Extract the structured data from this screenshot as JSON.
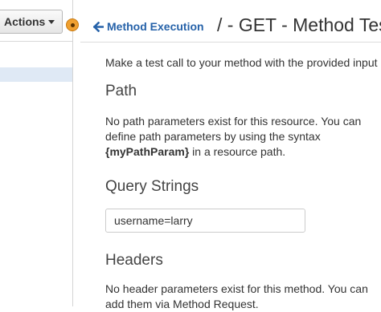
{
  "toolbar": {
    "actions_label": "Actions"
  },
  "header": {
    "back_label": "Method Execution",
    "title": "/ - GET - Method Test"
  },
  "main": {
    "intro": "Make a test call to your method with the provided input",
    "path": {
      "title": "Path",
      "text_before": "No path parameters exist for this resource. You can define path parameters by using the syntax ",
      "syntax": "{myPathParam}",
      "text_after": " in a resource path."
    },
    "query": {
      "title": "Query Strings",
      "value": "username=larry"
    },
    "headers": {
      "title": "Headers",
      "text": "No header parameters exist for this method. You can add them via Method Request."
    }
  },
  "colors": {
    "link": "#2662a9",
    "splitter_handle": "#f0a030"
  }
}
